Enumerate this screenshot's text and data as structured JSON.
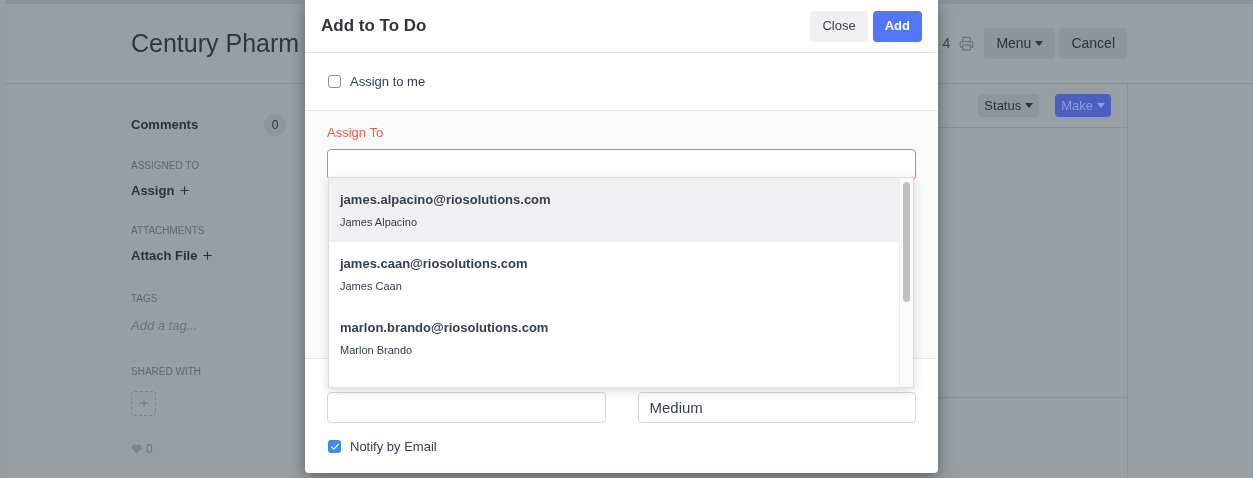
{
  "page": {
    "title": "Century Pharm",
    "doc_number": "4",
    "menu_button": "Menu",
    "cancel_button": "Cancel",
    "status_button": "Status",
    "make_button": "Make",
    "sidebar": {
      "comments": {
        "label": "Comments",
        "count": "0"
      },
      "sections": [
        {
          "heading": "ASSIGNED TO",
          "action": "Assign"
        },
        {
          "heading": "ATTACHMENTS",
          "action": "Attach File"
        }
      ],
      "tags": {
        "heading": "TAGS",
        "placeholder": "Add a tag..."
      },
      "shared_with": {
        "heading": "SHARED WITH"
      },
      "likes": "0"
    }
  },
  "dialog": {
    "title": "Add to To Do",
    "close_button": "Close",
    "add_button": "Add",
    "assign_to_me": {
      "label": "Assign to me",
      "checked": false
    },
    "assign_to": {
      "label": "Assign To",
      "invalid": true
    },
    "suggestions": [
      {
        "email": "james.alpacino@riosolutions.com",
        "name": "James Alpacino",
        "selected": true
      },
      {
        "email": "james.caan@riosolutions.com",
        "name": "James Caan",
        "selected": false
      },
      {
        "email": "marlon.brando@riosolutions.com",
        "name": "Marlon Brando",
        "selected": false
      }
    ],
    "priority_field": {
      "value": "Medium"
    },
    "notify_by_email": {
      "label": "Notify by Email",
      "checked": true
    }
  }
}
